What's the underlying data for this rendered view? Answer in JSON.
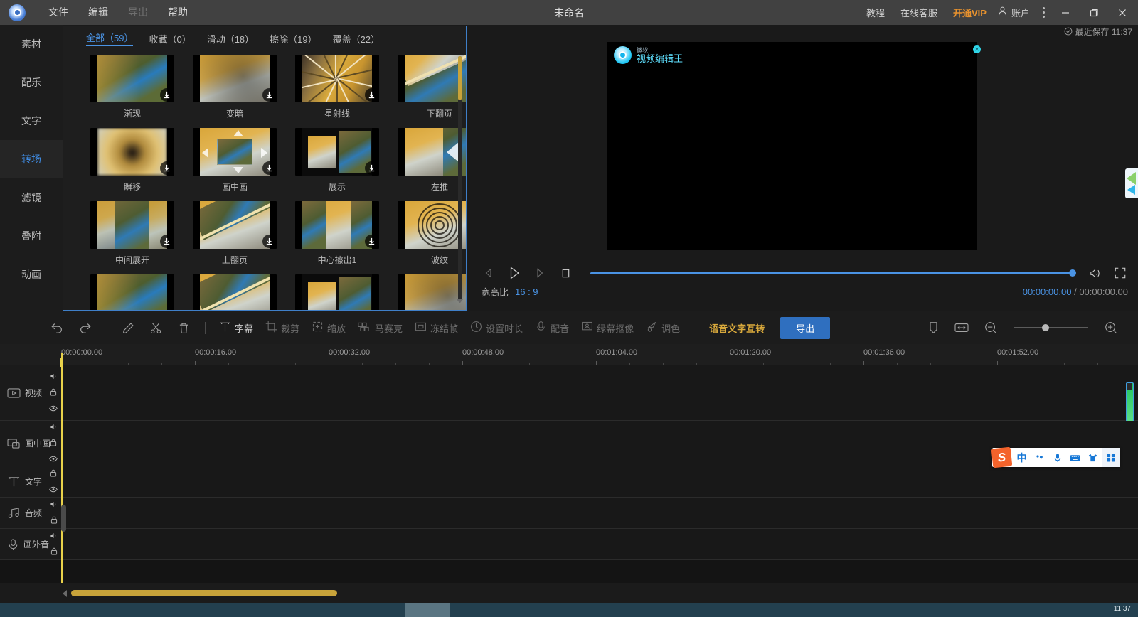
{
  "titlebar": {
    "logo_icon": "film-reel-icon",
    "menus": [
      {
        "label": "文件",
        "disabled": false
      },
      {
        "label": "编辑",
        "disabled": false
      },
      {
        "label": "导出",
        "disabled": true
      },
      {
        "label": "帮助",
        "disabled": false
      }
    ],
    "document_title": "未命名",
    "links": [
      {
        "label": "教程",
        "style": "normal"
      },
      {
        "label": "在线客服",
        "style": "normal"
      },
      {
        "label": "开通VIP",
        "style": "vip"
      }
    ],
    "account_label": "账户",
    "account_icon": "user-icon",
    "more_icon": "more-vertical-icon",
    "minimize_icon": "minimize-icon",
    "restore_icon": "restore-icon",
    "close_icon": "close-icon"
  },
  "savebar": {
    "icon": "check-circle-icon",
    "text": "最近保存 11:37"
  },
  "sidebar": {
    "items": [
      {
        "label": "素材",
        "active": false
      },
      {
        "label": "配乐",
        "active": false
      },
      {
        "label": "文字",
        "active": false
      },
      {
        "label": "转场",
        "active": true
      },
      {
        "label": "滤镜",
        "active": false
      },
      {
        "label": "叠附",
        "active": false
      },
      {
        "label": "动画",
        "active": false
      }
    ]
  },
  "panel": {
    "tabs": [
      {
        "label": "全部（59）",
        "active": true
      },
      {
        "label": "收藏（0）",
        "active": false
      },
      {
        "label": "滑动（18）",
        "active": false
      },
      {
        "label": "擦除（19）",
        "active": false
      },
      {
        "label": "覆盖（22）",
        "active": false
      }
    ],
    "download_icon": "download-icon",
    "items": [
      {
        "label": "渐现",
        "style": "fade"
      },
      {
        "label": "变暗",
        "style": "darken"
      },
      {
        "label": "星射线",
        "style": "starburst"
      },
      {
        "label": "下翻页",
        "style": "pagedown"
      },
      {
        "label": "瞬移",
        "style": "zoomblur"
      },
      {
        "label": "画中画",
        "style": "pip"
      },
      {
        "label": "展示",
        "style": "showcase"
      },
      {
        "label": "左推",
        "style": "pushleft"
      },
      {
        "label": "中间展开",
        "style": "splitmid"
      },
      {
        "label": "上翻页",
        "style": "pageup"
      },
      {
        "label": "中心擦出1",
        "style": "wipecenter"
      },
      {
        "label": "波纹",
        "style": "ripple"
      }
    ]
  },
  "preview": {
    "watermark": {
      "brand_small": "微软",
      "brand_big": "视频编辑王",
      "logo_icon": "film-reel-icon",
      "close_icon": "close-small-icon"
    },
    "controls": {
      "prev_frame_icon": "step-backward-icon",
      "play_icon": "play-icon",
      "next_frame_icon": "step-forward-icon",
      "stop_icon": "stop-icon",
      "volume_icon": "volume-icon",
      "fullscreen_icon": "fullscreen-icon"
    },
    "ratio_label": "宽高比",
    "ratio_value": "16 : 9",
    "current_time": "00:00:00.00",
    "time_separator": "/",
    "total_time": "00:00:00.00"
  },
  "toolbar": {
    "undo_icon": "undo-icon",
    "redo_icon": "redo-icon",
    "tools": [
      {
        "label": "",
        "icon": "pencil-icon",
        "state": "normal"
      },
      {
        "label": "",
        "icon": "scissors-icon",
        "state": "normal"
      },
      {
        "label": "",
        "icon": "trash-icon",
        "state": "normal"
      }
    ],
    "named_tools": [
      {
        "label": "字幕",
        "icon": "subtitle-icon",
        "state": "normal"
      },
      {
        "label": "裁剪",
        "icon": "crop-icon",
        "state": "dim"
      },
      {
        "label": "缩放",
        "icon": "scale-icon",
        "state": "dim"
      },
      {
        "label": "马赛克",
        "icon": "mosaic-icon",
        "state": "dim"
      },
      {
        "label": "冻结帧",
        "icon": "freeze-frame-icon",
        "state": "dim"
      },
      {
        "label": "设置时长",
        "icon": "clock-icon",
        "state": "dim"
      },
      {
        "label": "配音",
        "icon": "microphone-icon",
        "state": "dim"
      },
      {
        "label": "绿幕抠像",
        "icon": "green-screen-icon",
        "state": "dim"
      },
      {
        "label": "调色",
        "icon": "color-grading-icon",
        "state": "dim"
      }
    ],
    "voice_text_label": "语音文字互转",
    "export_label": "导出",
    "marker_icon": "marker-icon",
    "fit_icon": "fit-width-icon",
    "zoom_out_icon": "zoom-out-icon",
    "zoom_in_icon": "zoom-in-icon"
  },
  "timeline": {
    "ruler_labels": [
      "00:00:00.00",
      "00:00:16.00",
      "00:00:32.00",
      "00:00:48.00",
      "00:01:04.00",
      "00:01:20.00",
      "00:01:36.00",
      "00:01:52.00"
    ],
    "tracks": [
      {
        "label": "视频",
        "icon": "video-track-icon",
        "controls": [
          "volume-icon",
          "lock-icon",
          "eye-icon"
        ]
      },
      {
        "label": "画中画",
        "icon": "pip-track-icon",
        "controls": [
          "volume-icon",
          "lock-icon",
          "eye-icon"
        ]
      },
      {
        "label": "文字",
        "icon": "text-track-icon",
        "controls": [
          "lock-icon",
          "eye-icon"
        ]
      },
      {
        "label": "音频",
        "icon": "audio-track-icon",
        "controls": [
          "volume-icon",
          "lock-icon"
        ]
      },
      {
        "label": "画外音",
        "icon": "voiceover-track-icon",
        "controls": [
          "volume-icon",
          "lock-icon"
        ]
      }
    ]
  },
  "ime": {
    "logo": "S",
    "buttons": [
      {
        "icon": "chinese-mode-icon",
        "label": "中"
      },
      {
        "icon": "punctuation-icon",
        "label": ""
      },
      {
        "icon": "microphone-icon",
        "label": ""
      },
      {
        "icon": "keyboard-icon",
        "label": ""
      },
      {
        "icon": "skin-icon",
        "label": ""
      },
      {
        "icon": "toolbox-icon",
        "label": ""
      }
    ]
  },
  "taskbar": {
    "clock": "11:37"
  }
}
